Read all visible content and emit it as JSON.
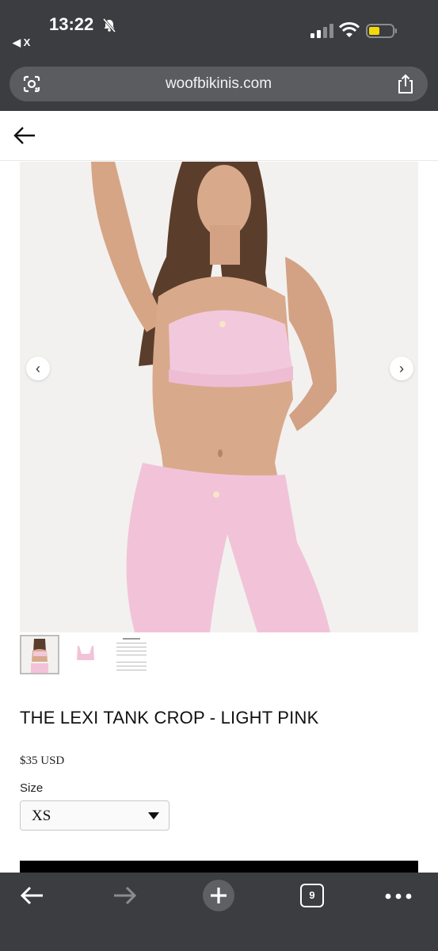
{
  "status": {
    "time": "13:22",
    "back_app": "◀ X"
  },
  "browser": {
    "url": "woofbikinis.com",
    "tab_count": "9"
  },
  "gallery": {
    "prev": "‹",
    "next": "›"
  },
  "product": {
    "title": "THE LEXI TANK CROP - LIGHT PINK",
    "price": "$35 USD",
    "size_label": "Size",
    "size_value": "XS"
  },
  "colors": {
    "chrome": "#3b3d40",
    "product_pink": "#f2c3d8",
    "button": "#000000"
  }
}
